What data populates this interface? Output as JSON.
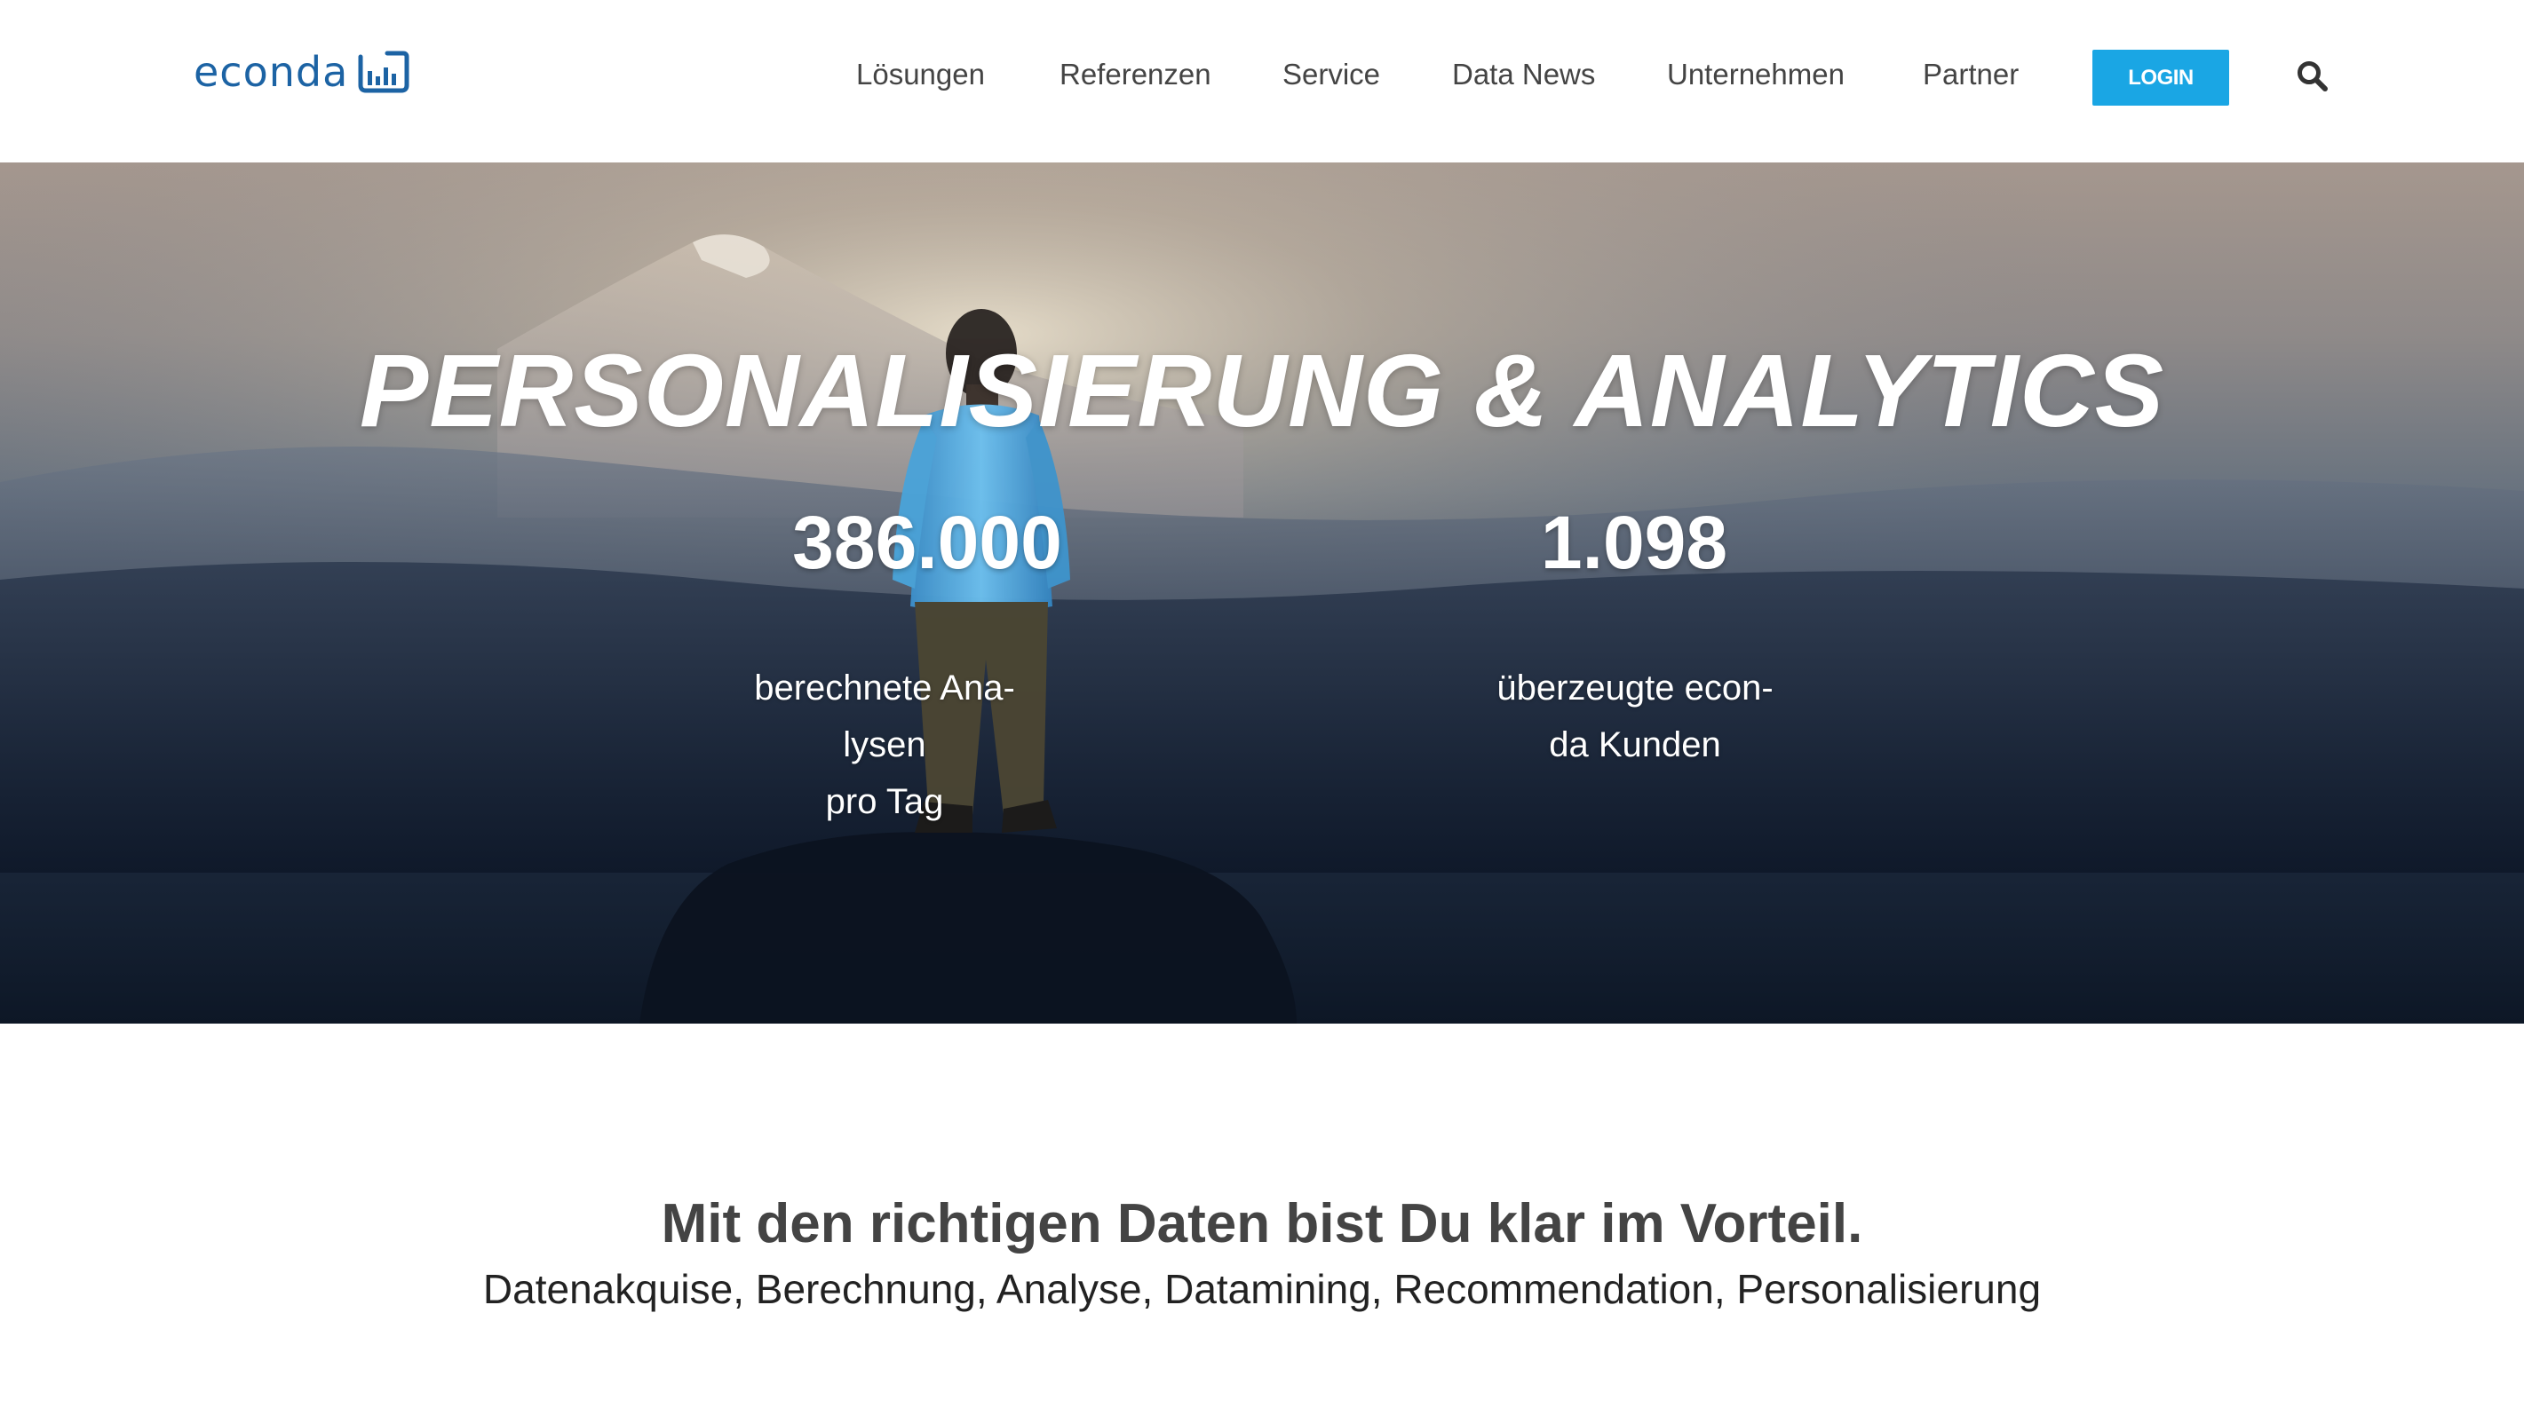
{
  "brand": {
    "name": "econda",
    "logo_icon": "bar-chart-icon",
    "color": "#1c63a4"
  },
  "nav": {
    "items": [
      {
        "label": "Lösungen"
      },
      {
        "label": "Referenzen"
      },
      {
        "label": "Service"
      },
      {
        "label": "Data News"
      },
      {
        "label": "Unternehmen"
      },
      {
        "label": "Partner"
      }
    ],
    "login_label": "LOGIN",
    "login_color": "#1aa6e4",
    "search_icon": "search-icon"
  },
  "hero": {
    "title": "PERSONALISIERUNG & ANALYTICS",
    "stats": [
      {
        "value": "386.000",
        "label_lines": [
          "berechnete Ana-",
          "lysen",
          "pro Tag"
        ]
      },
      {
        "value": "1.098",
        "label_lines": [
          "überzeugte econ-",
          "da Kunden"
        ]
      }
    ]
  },
  "intro": {
    "heading": "Mit den richtigen Daten bist Du klar im Vorteil.",
    "subheading": "Datenakquise, Berechnung, Analyse, Datamining, Recommendation, Personalisierung"
  }
}
